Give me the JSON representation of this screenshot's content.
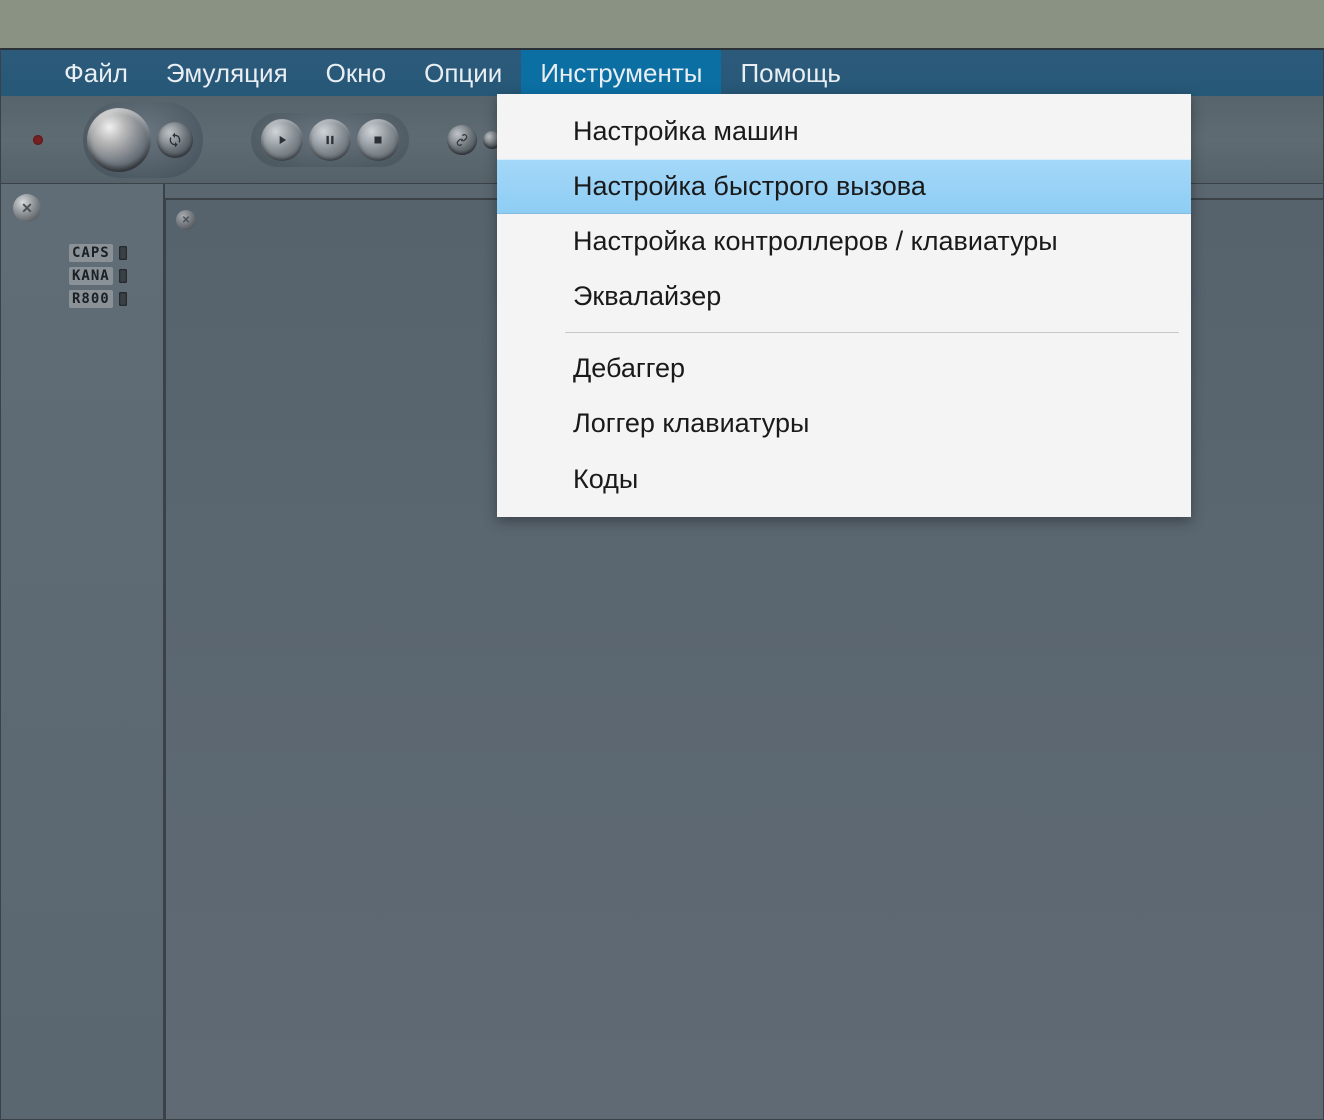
{
  "menubar": {
    "items": [
      {
        "label": "Файл"
      },
      {
        "label": "Эмуляция"
      },
      {
        "label": "Окно"
      },
      {
        "label": "Опции"
      },
      {
        "label": "Инструменты"
      },
      {
        "label": "Помощь"
      }
    ],
    "active_index": 4
  },
  "dropdown": {
    "items": [
      {
        "label": "Настройка машин",
        "highlight": false
      },
      {
        "label": "Настройка быстрого вызова",
        "highlight": true
      },
      {
        "label": "Настройка контроллеров / клавиатуры",
        "highlight": false
      },
      {
        "label": "Эквалайзер",
        "highlight": false
      }
    ],
    "items2": [
      {
        "label": "Дебаггер"
      },
      {
        "label": "Логгер клавиатуры"
      },
      {
        "label": "Коды"
      }
    ]
  },
  "side_panel": {
    "indicators": [
      {
        "label": "CAPS"
      },
      {
        "label": "KANA"
      },
      {
        "label": "R800"
      }
    ]
  },
  "icons": {
    "play": "play-icon",
    "pause": "pause-icon",
    "stop": "stop-icon",
    "link": "link-icon",
    "refresh": "refresh-icon"
  }
}
